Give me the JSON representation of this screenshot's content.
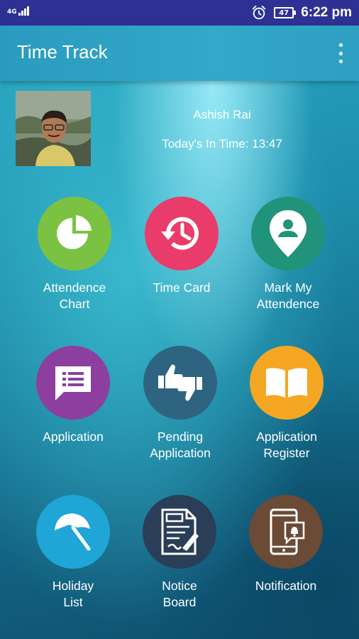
{
  "status_bar": {
    "network": "4G",
    "battery": "47",
    "time": "6:22 pm",
    "icons": [
      "signal-icon",
      "alarm-icon",
      "battery-icon"
    ]
  },
  "app_bar": {
    "title": "Time Track",
    "menu_icon": "overflow-menu-icon"
  },
  "profile": {
    "name": "Ashish Rai",
    "in_time_label": "Today's In Time:",
    "in_time_value": "13:47"
  },
  "tiles": [
    {
      "label": "Attendence\nChart",
      "icon": "pie-chart-icon",
      "color": "#7cc242"
    },
    {
      "label": "Time Card",
      "icon": "history-clock-icon",
      "color": "#ea3c6a"
    },
    {
      "label": "Mark My\nAttendence",
      "icon": "location-pin-icon",
      "color": "#21937a"
    },
    {
      "label": "Application",
      "icon": "message-list-icon",
      "color": "#8c3f9e"
    },
    {
      "label": "Pending\nApplication",
      "icon": "thumbs-up-down-icon",
      "color": "#2f6480"
    },
    {
      "label": "Application\nRegister",
      "icon": "open-book-icon",
      "color": "#f5a623"
    },
    {
      "label": "Holiday\nList",
      "icon": "beach-umbrella-icon",
      "color": "#1fa5d6"
    },
    {
      "label": "Notice\nBoard",
      "icon": "notice-edit-icon",
      "color": "#2b3e57"
    },
    {
      "label": "Notification",
      "icon": "phone-bell-icon",
      "color": "#6b4a36"
    }
  ]
}
